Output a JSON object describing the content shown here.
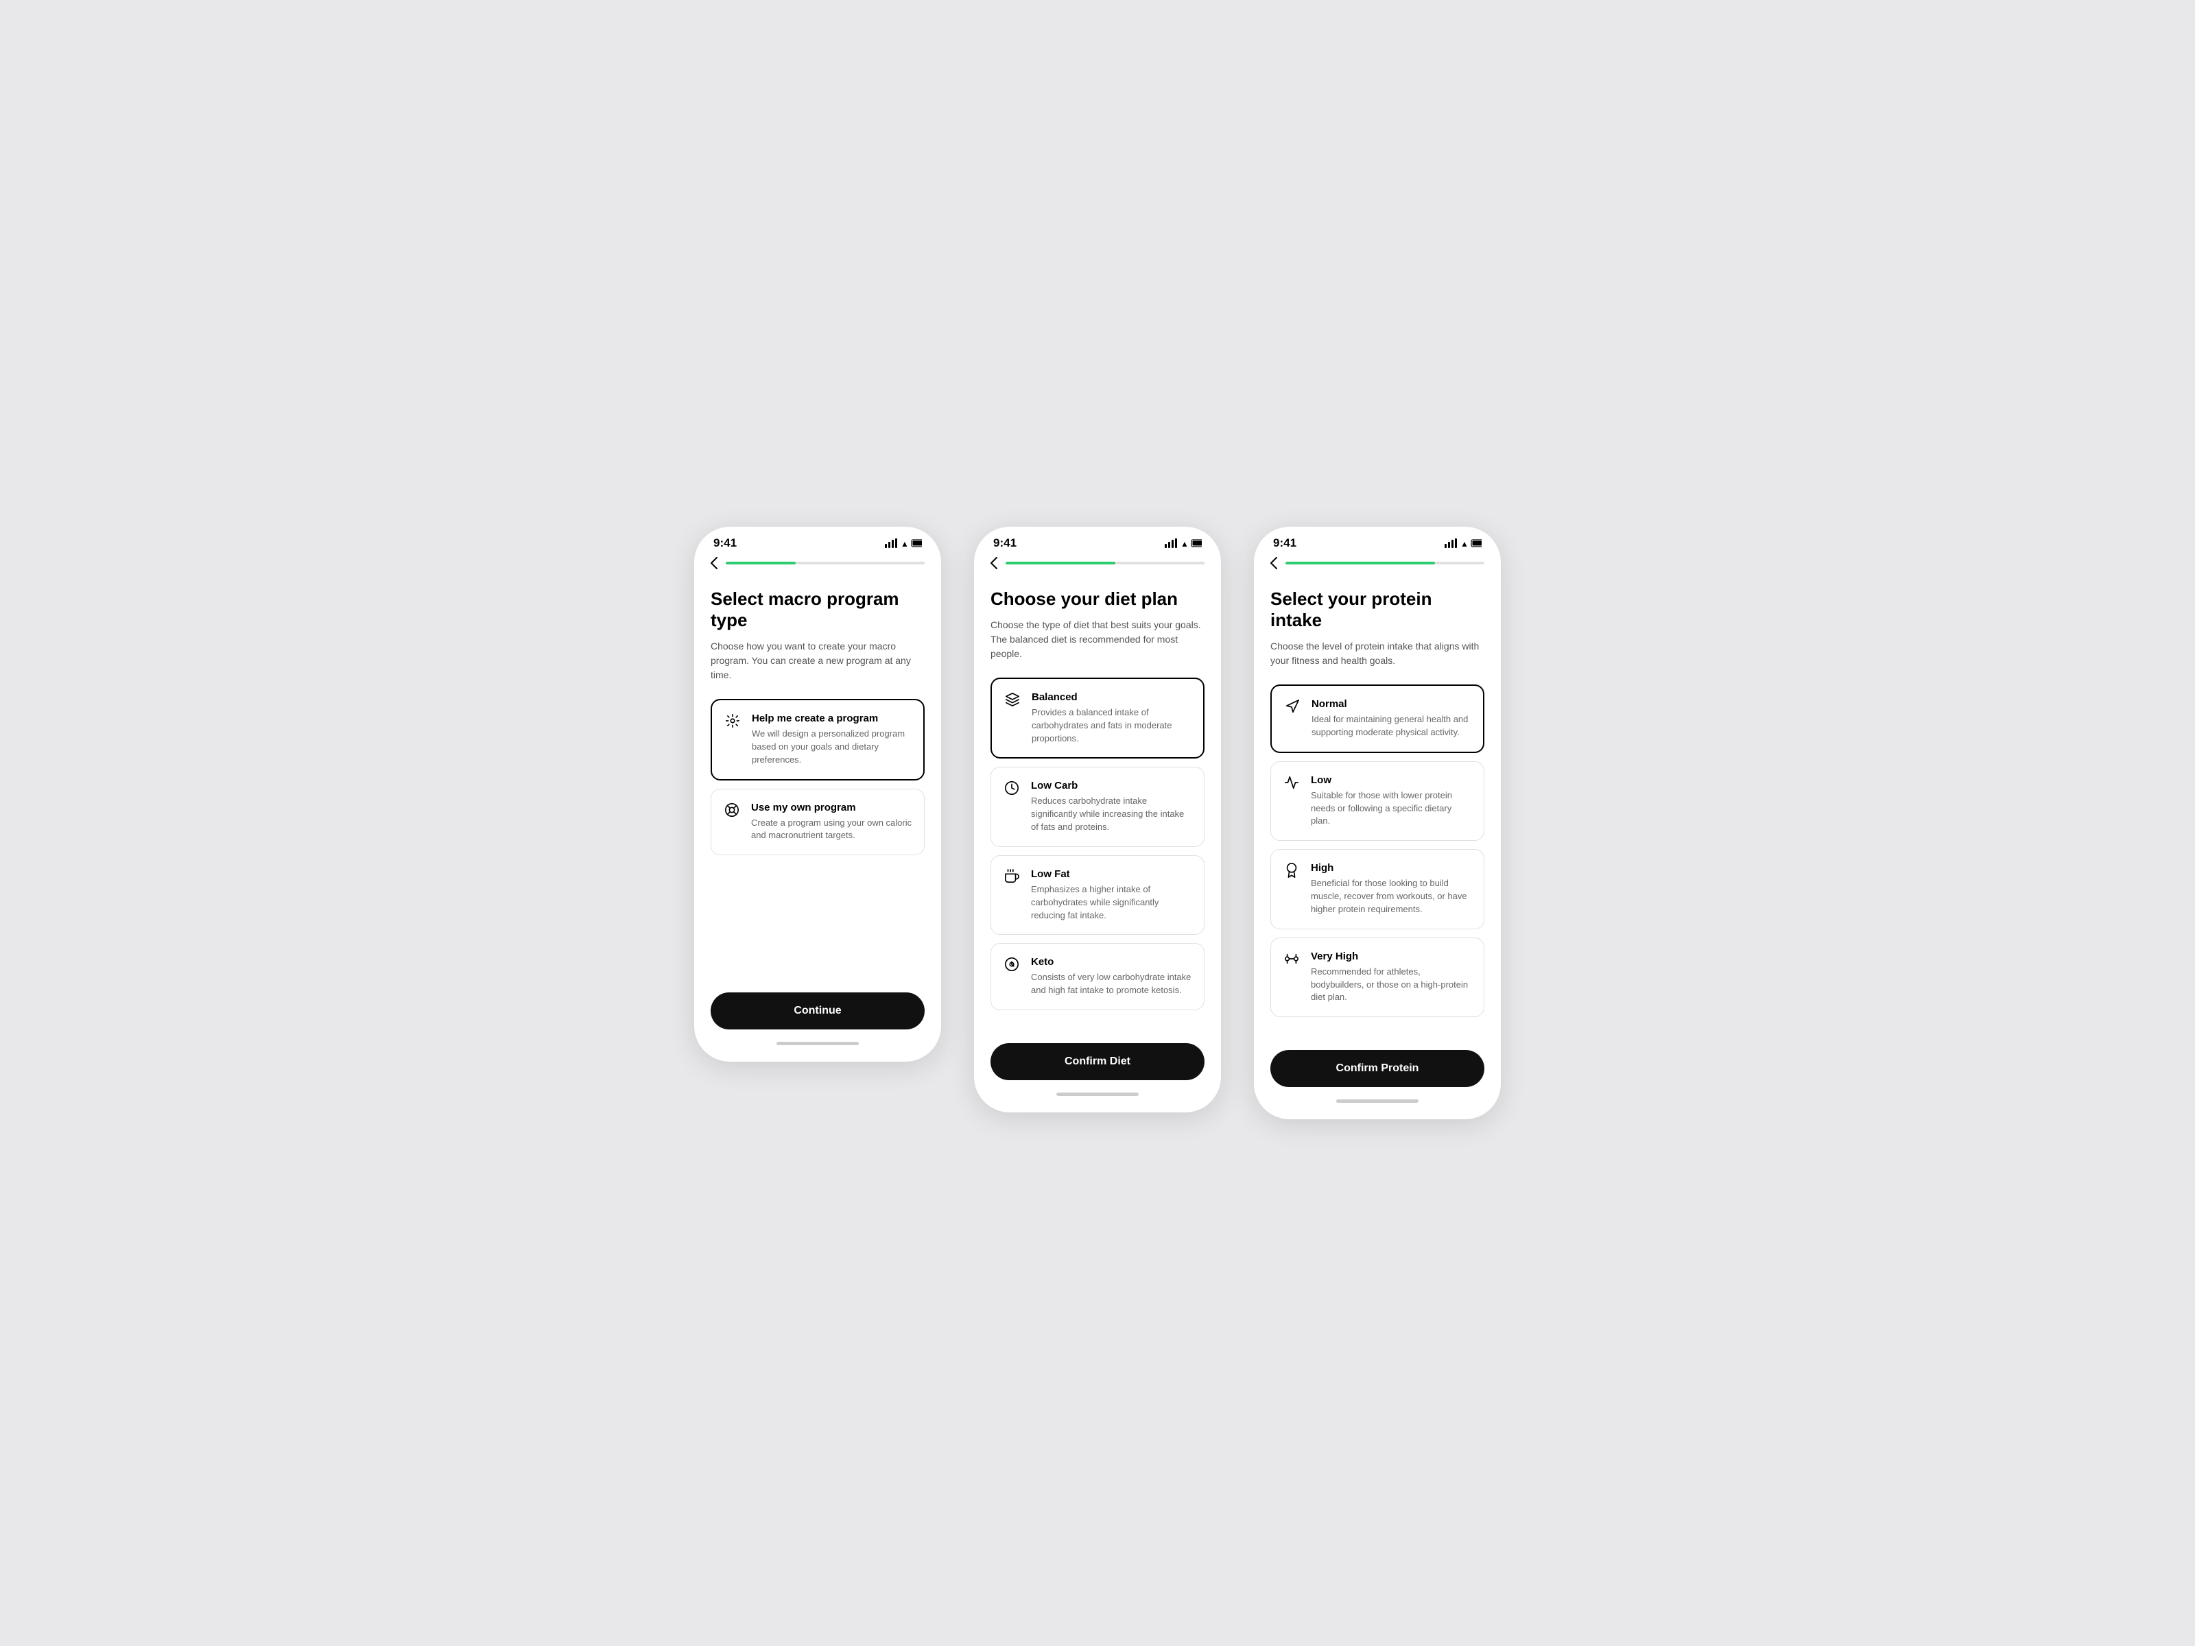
{
  "screens": [
    {
      "id": "screen-1",
      "statusTime": "9:41",
      "progressPercent": 35,
      "title": "Select macro program type",
      "subtitle": "Choose how you want to create your macro program. You can create a new program at any time.",
      "options": [
        {
          "id": "help-create",
          "selected": true,
          "icon": "⚖",
          "title": "Help me create a program",
          "description": "We will design a personalized program based on your goals and dietary preferences."
        },
        {
          "id": "own-program",
          "selected": false,
          "icon": "🎯",
          "title": "Use my own program",
          "description": "Create a program using your own caloric and macronutrient targets."
        }
      ],
      "ctaLabel": "Continue"
    },
    {
      "id": "screen-2",
      "statusTime": "9:41",
      "progressPercent": 55,
      "title": "Choose your diet plan",
      "subtitle": "Choose the type of diet that best suits your goals. The balanced diet is recommended for most people.",
      "options": [
        {
          "id": "balanced",
          "selected": true,
          "icon": "⚖",
          "title": "Balanced",
          "description": "Provides a balanced intake of carbohydrates and fats in moderate proportions."
        },
        {
          "id": "low-carb",
          "selected": false,
          "icon": "💧",
          "title": "Low Carb",
          "description": "Reduces carbohydrate intake significantly while increasing the intake of fats and proteins."
        },
        {
          "id": "low-fat",
          "selected": false,
          "icon": "☕",
          "title": "Low Fat",
          "description": "Emphasizes a higher intake of carbohydrates while significantly reducing fat intake."
        },
        {
          "id": "keto",
          "selected": false,
          "icon": "⚙",
          "title": "Keto",
          "description": "Consists of very low carbohydrate intake and high fat intake to promote ketosis."
        }
      ],
      "ctaLabel": "Confirm Diet"
    },
    {
      "id": "screen-3",
      "statusTime": "9:41",
      "progressPercent": 75,
      "title": "Select your protein intake",
      "subtitle": "Choose the level of protein intake that aligns with your fitness and health goals.",
      "options": [
        {
          "id": "normal",
          "selected": true,
          "icon": "🍽",
          "title": "Normal",
          "description": "Ideal for maintaining general health and supporting moderate physical activity."
        },
        {
          "id": "low",
          "selected": false,
          "icon": "🌱",
          "title": "Low",
          "description": "Suitable for those with lower protein needs or following a specific dietary plan."
        },
        {
          "id": "high",
          "selected": false,
          "icon": "🏃",
          "title": "High",
          "description": "Beneficial for those looking to build muscle, recover from workouts, or have higher protein requirements."
        },
        {
          "id": "very-high",
          "selected": false,
          "icon": "🏋",
          "title": "Very High",
          "description": "Recommended for athletes, bodybuilders, or those on a high-protein diet plan."
        }
      ],
      "ctaLabel": "Confirm Protein"
    }
  ]
}
